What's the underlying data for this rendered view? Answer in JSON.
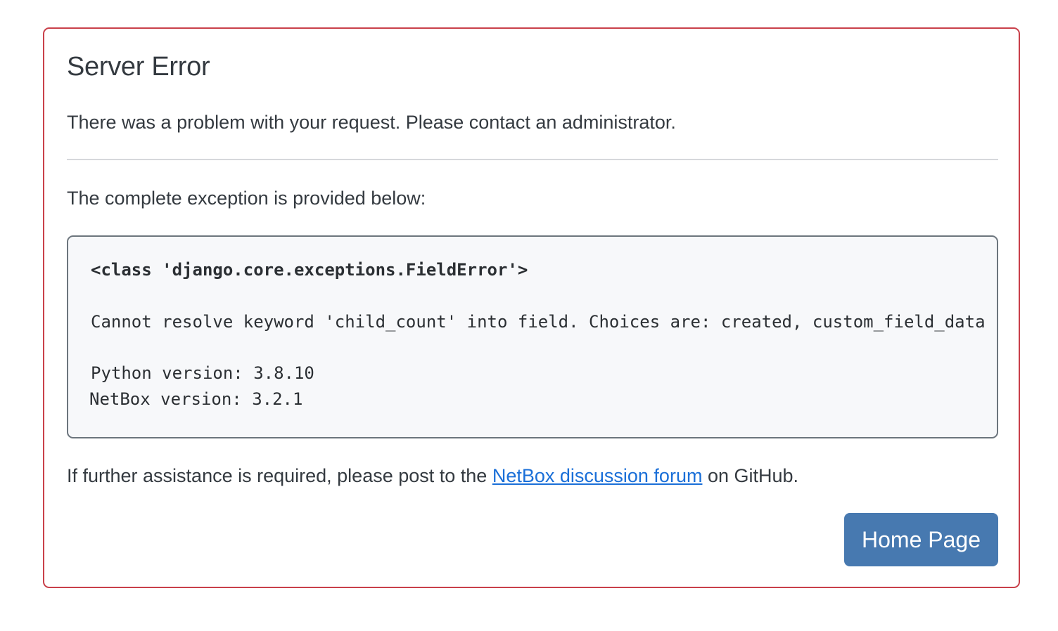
{
  "error": {
    "title": "Server Error",
    "message": "There was a problem with your request. Please contact an administrator.",
    "exception_intro": "The complete exception is provided below:",
    "exception": {
      "class_line": "<class 'django.core.exceptions.FieldError'>",
      "message_line": "Cannot resolve keyword 'child_count' into field. Choices are: created, custom_field_data",
      "python_version_line": "Python version: 3.8.10",
      "netbox_version_line": "NetBox version: 3.2.1"
    },
    "help": {
      "prefix": "If further assistance is required, please post to the ",
      "link_text": "NetBox discussion forum",
      "suffix": " on GitHub."
    },
    "home_button_label": "Home Page"
  },
  "colors": {
    "card_border": "#c9404a",
    "link": "#1a6fd8",
    "button_bg": "#4779b0",
    "code_bg": "#f7f8fa"
  }
}
